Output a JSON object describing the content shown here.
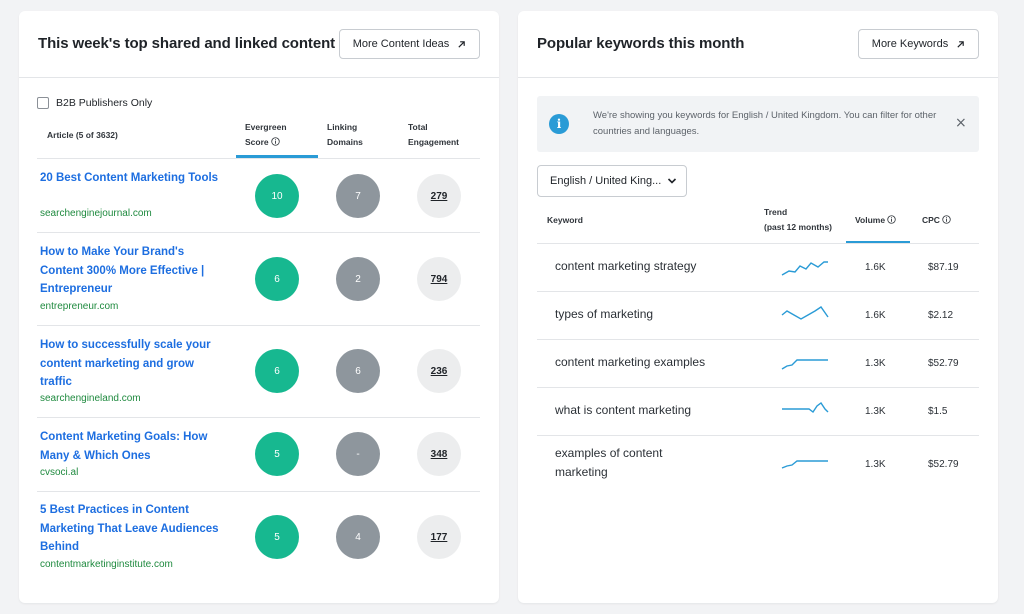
{
  "left_card": {
    "title": "This week's top shared and linked content",
    "more_button": "More Content Ideas",
    "checkbox_label": "B2B Publishers Only",
    "columns": {
      "article": "Article (5 of 3632)",
      "evergreen_1": "Evergreen",
      "evergreen_2": "Score",
      "linking_1": "Linking",
      "linking_2": "Domains",
      "engagement_1": "Total",
      "engagement_2": "Engagement"
    },
    "articles": [
      {
        "title": "20 Best Content Marketing Tools",
        "domain": "searchenginejournal.com",
        "evergreen": "10",
        "linking": "7",
        "engagement": "279"
      },
      {
        "title": "How to Make Your Brand's Content 300% More Effective | Entrepreneur",
        "domain": "entrepreneur.com",
        "evergreen": "6",
        "linking": "2",
        "engagement": "794"
      },
      {
        "title": "How to successfully scale your content marketing and grow traffic",
        "domain": "searchengineland.com",
        "evergreen": "6",
        "linking": "6",
        "engagement": "236"
      },
      {
        "title": "Content Marketing Goals: How Many & Which Ones",
        "domain": "cvsoci.al",
        "evergreen": "5",
        "linking": "-",
        "engagement": "348"
      },
      {
        "title": "5 Best Practices in Content Marketing That Leave Audiences Behind",
        "domain": "contentmarketinginstitute.com",
        "evergreen": "5",
        "linking": "4",
        "engagement": "177"
      }
    ]
  },
  "right_card": {
    "title": "Popular keywords this month",
    "more_button": "More Keywords",
    "notice": "We're showing you keywords for English / United Kingdom. You can filter for other countries and languages.",
    "notice_icon": "i",
    "close_glyph": "×",
    "select_value": "English / United King...",
    "columns": {
      "keyword": "Keyword",
      "trend_1": "Trend",
      "trend_2": "(past 12 months)",
      "volume": "Volume",
      "cpc": "CPC"
    },
    "keywords": [
      {
        "keyword": "content marketing strategy",
        "volume": "1.6K",
        "cpc": "$87.19"
      },
      {
        "keyword": "types of marketing",
        "volume": "1.6K",
        "cpc": "$2.12"
      },
      {
        "keyword": "content marketing examples",
        "volume": "1.3K",
        "cpc": "$52.79"
      },
      {
        "keyword": "what is content marketing",
        "volume": "1.3K",
        "cpc": "$1.5"
      },
      {
        "keyword": "examples of content marketing",
        "volume": "1.3K",
        "cpc": "$52.79"
      }
    ]
  },
  "colors": {
    "link": "#1d6ee0",
    "domain": "#1f8a3f",
    "evergreen": "#17b890",
    "linking": "#8e969d",
    "accent": "#2a9bd6"
  }
}
